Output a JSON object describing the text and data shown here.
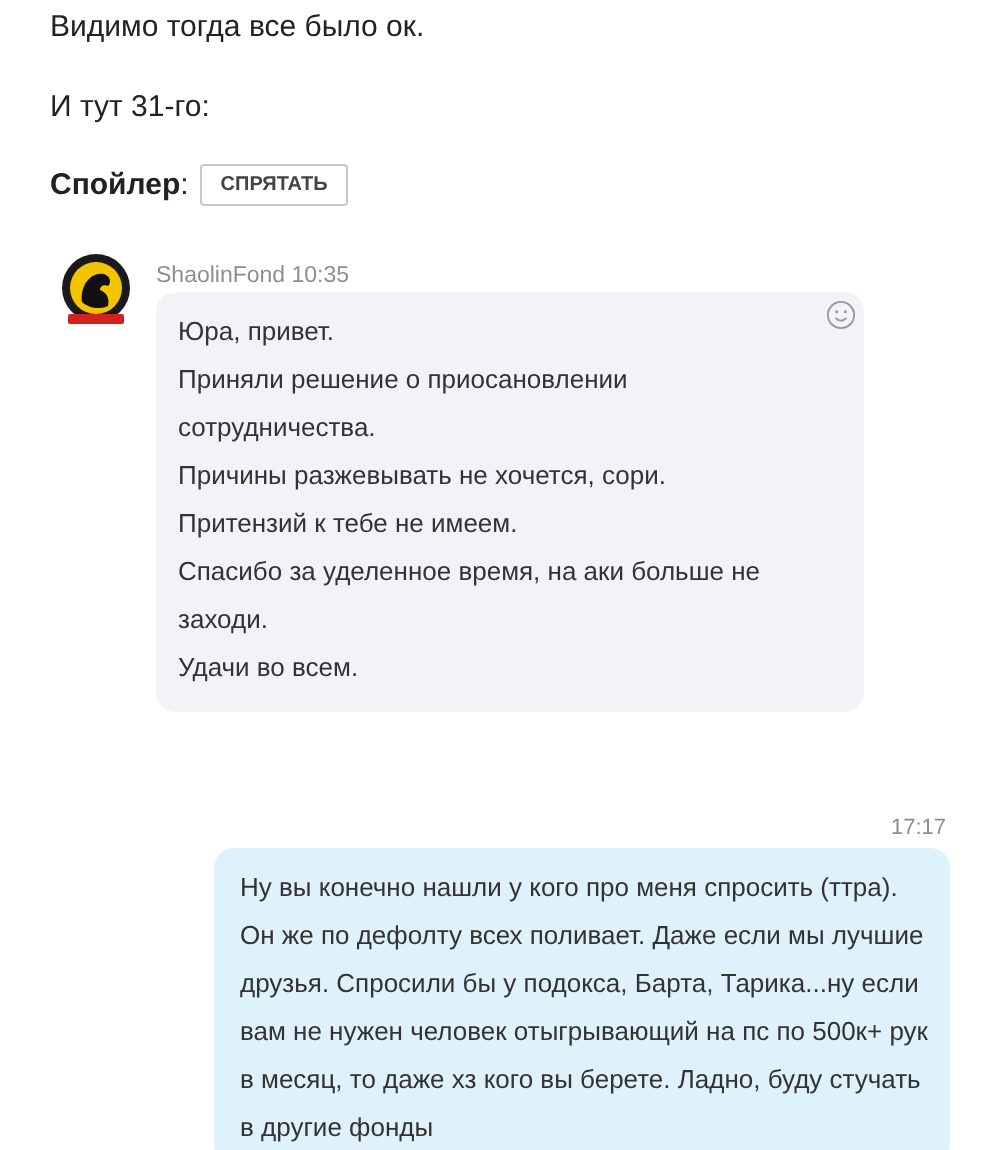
{
  "intro": [
    "Видимо тогда все было ок.",
    "И тут 31-го:"
  ],
  "spoiler": {
    "label": "**Спойлер**:",
    "button": "СПРЯТАТЬ"
  },
  "incoming": {
    "author": "ShaolinFond 10:35",
    "paragraphs": [
      "Юра, привет.",
      "Приняли решение о приосановлении сотрудничества.",
      "Причины разжевывать не хочется, сори.",
      "Притензий к тебе не имеем.",
      "Спасибо за уделенное время, на аки больше не заходи.",
      "Удачи во всем."
    ]
  },
  "outgoing": {
    "time": "17:17",
    "text": "Ну вы конечно нашли у кого про меня спросить (ттра). Он же по дефолту всех поливает. Даже если мы лучшие друзья. Спросили бы у подокса, Барта, Тарика...ну если вам не нужен человек отыгрывающий на пс по 500к+ рук в месяц, то даже хз кого вы берете. Ладно, буду стучать в другие фонды"
  }
}
